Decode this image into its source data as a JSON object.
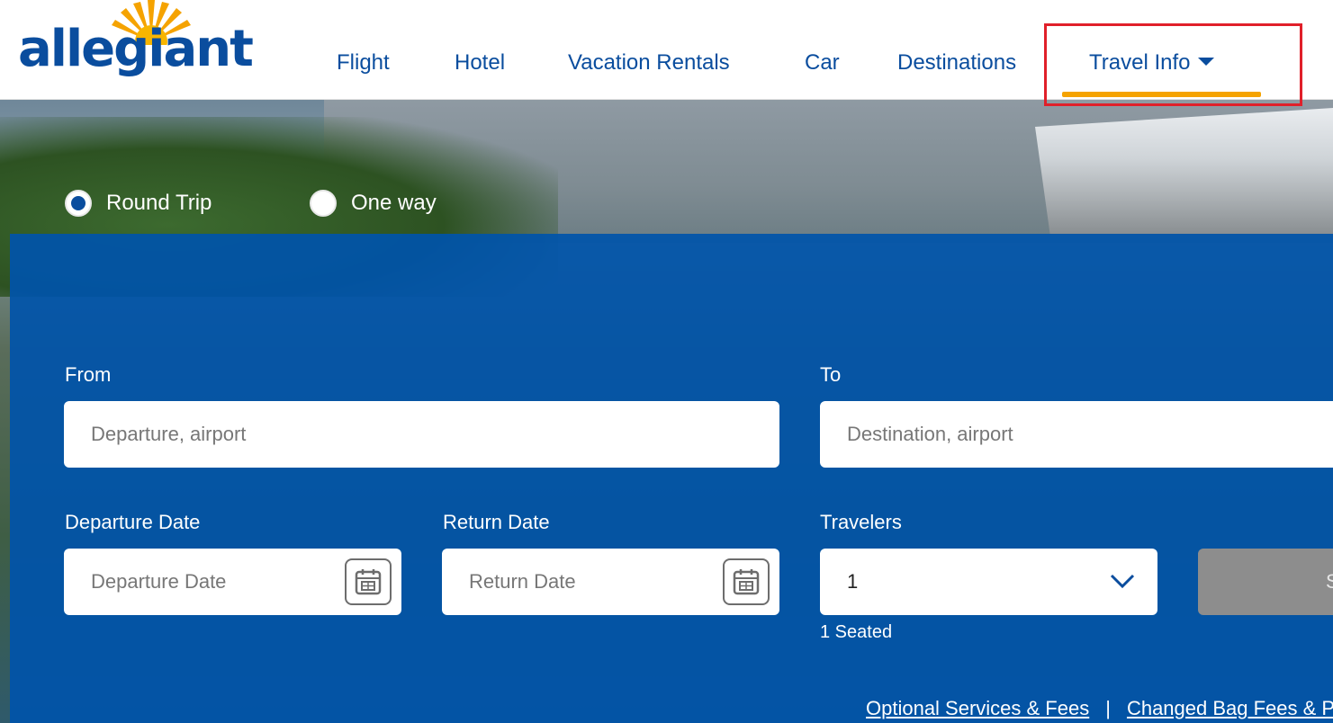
{
  "brand": {
    "logo_text": "allegiant"
  },
  "nav": {
    "items": [
      "Flight",
      "Hotel",
      "Vacation Rentals",
      "Car",
      "Destinations",
      "Travel Info"
    ],
    "active": "Travel Info"
  },
  "booking": {
    "trip_types": [
      "Round Trip",
      "One way"
    ],
    "selected_trip_type": "Round Trip",
    "from": {
      "label": "From",
      "placeholder": "Departure, airport"
    },
    "to": {
      "label": "To",
      "placeholder": "Destination, airport"
    },
    "departure": {
      "label": "Departure Date",
      "placeholder": "Departure Date"
    },
    "return": {
      "label": "Return Date",
      "placeholder": "Return Date"
    },
    "travelers": {
      "label": "Travelers",
      "value": "1",
      "note": "1 Seated"
    },
    "search_label": "S"
  },
  "footer_links": [
    "Optional Services & Fees",
    "Changed Bag Fees & P"
  ],
  "footer_separator": "|",
  "colors": {
    "brand_blue": "#0a4d9e",
    "panel_blue": "#0054aa",
    "active_underline": "#f5a300",
    "highlight_box": "#e0202a",
    "search_button": "#8d8d8d"
  },
  "icons": [
    "sun-logo-icon",
    "caret-down-icon",
    "calendar-icon",
    "chevron-down-icon"
  ]
}
